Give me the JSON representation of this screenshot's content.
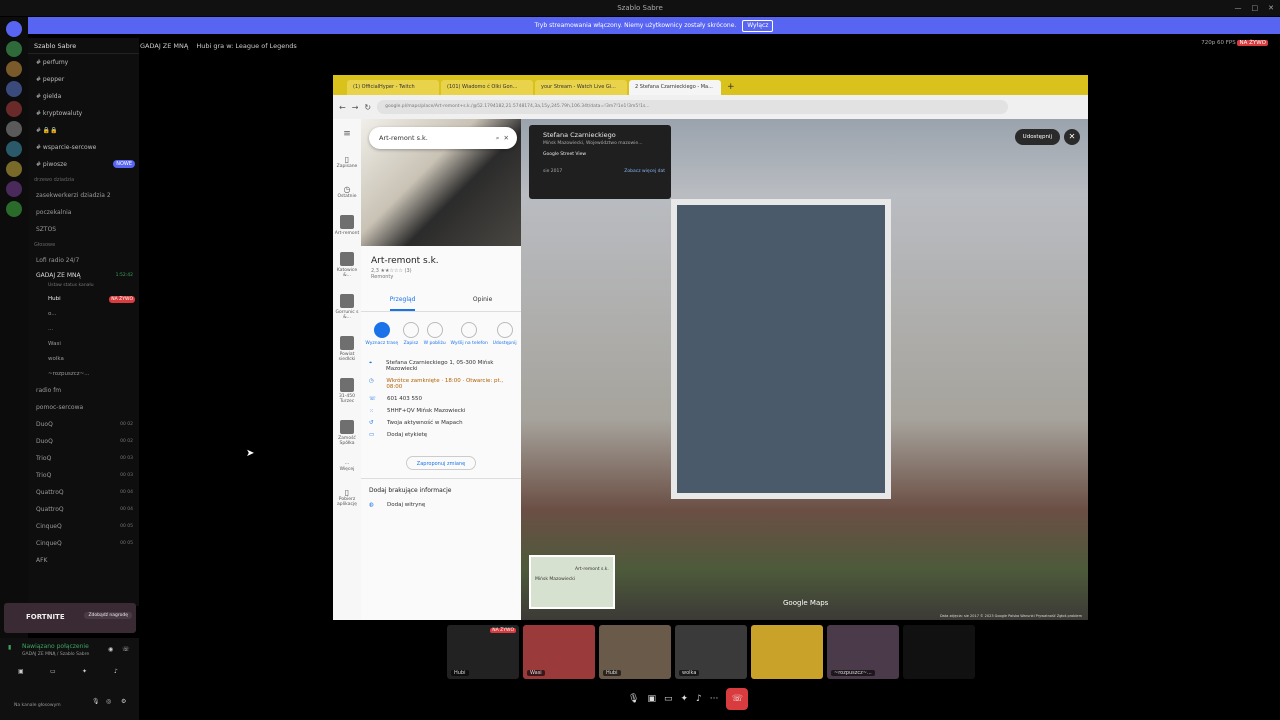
{
  "window": {
    "title": "Szablo Sabre"
  },
  "banner": {
    "text": "Tryb streamowania włączony. Niemy użytkownicy zostały skrócone.",
    "button": "Wyłącz"
  },
  "server": {
    "name": "Szablo Sabre"
  },
  "channels": [
    {
      "label": "# perfumy"
    },
    {
      "label": "# pepper"
    },
    {
      "label": "# gielda"
    },
    {
      "label": "# kryptowaluty"
    },
    {
      "label": "# 🔒🔒"
    },
    {
      "label": "# wsparcie-sercowe"
    },
    {
      "label": "# piwosze",
      "badge": "NOWE"
    }
  ],
  "categories": {
    "drzewo": "drzewo dziadzia",
    "glosowe": "Głosowe"
  },
  "voice_top": [
    {
      "label": "zasekwerkerzi dziadzia 2"
    },
    {
      "label": "poczekalnia"
    },
    {
      "label": "SZTOS"
    }
  ],
  "voice_channels": [
    {
      "label": "Lofi radio 24/7"
    },
    {
      "label": "GADAJ ZE MNĄ",
      "timer": "1:52:42",
      "status": "Ustaw status kanału"
    }
  ],
  "voice_users": [
    {
      "name": "Hubi",
      "live": "NA ŻYWO"
    },
    {
      "name": "o..."
    },
    {
      "name": "..."
    },
    {
      "name": "Wasi"
    },
    {
      "name": "wolka"
    },
    {
      "name": "~rozpuszcz~..."
    }
  ],
  "more_channels": [
    {
      "label": "radio fm"
    },
    {
      "label": "pomoc-sercowa"
    },
    {
      "label": "DuoQ",
      "nums": "00  02"
    },
    {
      "label": "DuoQ",
      "nums": "00  02"
    },
    {
      "label": "TrioQ",
      "nums": "00  03"
    },
    {
      "label": "TrioQ",
      "nums": "00  03"
    },
    {
      "label": "QuattroQ",
      "nums": "00  04"
    },
    {
      "label": "QuattroQ",
      "nums": "00  04"
    },
    {
      "label": "CinqueQ",
      "nums": "00  05"
    },
    {
      "label": "CinqueQ",
      "nums": "00  05"
    },
    {
      "label": "AFK"
    }
  ],
  "promo": {
    "title": "FORTNITE",
    "button": "Zdobądź nagrodę"
  },
  "connection": {
    "status": "Nawiązano połączenie",
    "channel": "GADAJ ZE MNĄ / Szablo Sabre",
    "user_status": "Na kanale głosowym"
  },
  "top_strip": {
    "channel": "GADAJ ZE MNĄ",
    "activity": "Hubi gra w: League of Legends"
  },
  "stream_status": {
    "quality": "720p 60 FPS",
    "live": "NA ŻYWO"
  },
  "browser": {
    "tabs": [
      "(1) OfficialHyper - Twitch",
      "(101) Wiadomo ć Olki Gon...",
      "your Stream - Watch Live Gi...",
      "2 Stefana Czarnieckiego - Ma..."
    ],
    "url": "google.pl/maps/place/Art-remont+s.k./@52.1794182,21.5748174,3a,15y,245.79h,106.34t/data=!3m7!1e1!3m5!1s..."
  },
  "maps": {
    "search": "Art-remont s.k.",
    "nav": [
      {
        "label": "Zapisane"
      },
      {
        "label": "Ostatnie"
      },
      {
        "label": "Art-remont"
      },
      {
        "label": "Katowice &..."
      },
      {
        "label": "Gorrunic s &..."
      },
      {
        "label": "Powiat siedlcki"
      },
      {
        "label": "31-450 Turzec"
      },
      {
        "label": "Zamość Spółka"
      },
      {
        "label": "Więcej"
      },
      {
        "label": "Pobierz aplikację"
      }
    ],
    "business": {
      "name": "Art-remont s.k.",
      "rating": "2,3 ★★☆☆☆ (3)",
      "category": "Remonty"
    },
    "tabs": {
      "overview": "Przegląd",
      "reviews": "Opinie"
    },
    "actions": [
      "Wyznacz trasę",
      "Zapisz",
      "W pobliżu",
      "Wyślij na telefon",
      "Udostępnij"
    ],
    "address": "Stefana Czarnieckiego 1, 05-300 Mińsk Mazowiecki",
    "hours": "Wkrótce zamknięte · 18:00 · Otwarcie: pt., 08:00",
    "phone": "601 403 550",
    "plus_code": "5HHF+QV Mińsk Mazowiecki",
    "activity": "Twoja aktywność w Mapach",
    "label": "Dodaj etykietę",
    "suggest": "Zaproponuj zmianę",
    "add_missing": "Dodaj brakujące informacje",
    "add_website": "Dodaj witrynę"
  },
  "streetview": {
    "place": "Stefana Czarnieckiego",
    "region": "Mińsk Mazowiecki, Województwo mazowie...",
    "source": "Google Street View",
    "date": "sie 2017",
    "more_dates": "Zobacz więcej dat",
    "share": "Udostępnij",
    "brand": "Google Maps",
    "minimap_label": "Art-remont s.k.",
    "minimap_city": "Mińsk Mazowiecki",
    "attribution": "Data zdjęcia: sie 2017  © 2023 Google  Polska  Warunki  Prywatność  Zgłoś problem"
  },
  "participants": [
    {
      "name": "Hubi",
      "live": "NA ŻYWO"
    },
    {
      "name": "Wasi"
    },
    {
      "name": "Hubi"
    },
    {
      "name": "wolka"
    },
    {
      "name": ""
    },
    {
      "name": "~rozpuszcz~..."
    },
    {
      "name": ""
    }
  ]
}
